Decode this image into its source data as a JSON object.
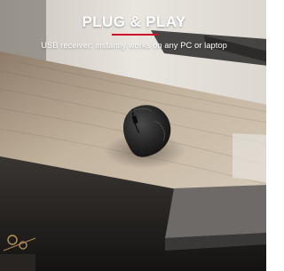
{
  "banner": {
    "headline": "PLUG & PLAY",
    "subline": "USB receiver; instantly works on any PC or laptop"
  },
  "colors": {
    "accent": "#d0102a",
    "text": "#ffffff"
  },
  "scene": {
    "subject": "mouse-icon"
  }
}
